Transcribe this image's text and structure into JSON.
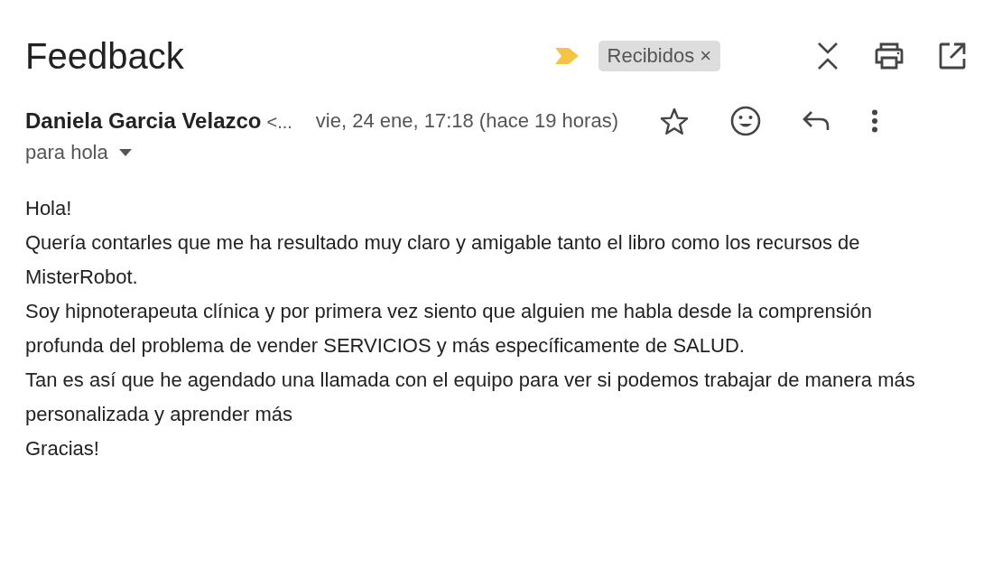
{
  "subject": "Feedback",
  "label": {
    "name": "Recibidos",
    "remove": "×"
  },
  "message": {
    "sender": "Daniela Garcia Velazco",
    "sender_email": "<...",
    "date": "vie, 24 ene, 17:18 (hace 19 horas)",
    "starred": false,
    "recipient": "para hola",
    "body": [
      "Hola!",
      "Quería contarles que me ha resultado muy claro y amigable tanto el libro como los recursos de MisterRobot.",
      "Soy hipnoterapeuta clínica y por primera vez siento que alguien me habla desde la comprensión profunda del problema de vender SERVICIOS y más específicamente de SALUD.",
      "Tan es así que he agendado una llamada con el equipo para ver si podemos trabajar de manera más personalizada y aprender más",
      "Gracias!"
    ]
  }
}
